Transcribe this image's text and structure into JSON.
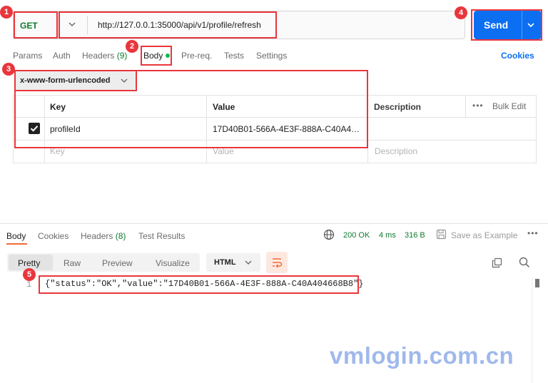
{
  "request": {
    "method": "GET",
    "url": "http://127.0.0.1:35000/api/v1/profile/refresh",
    "send_label": "Send"
  },
  "request_tabs": [
    {
      "label": "Params"
    },
    {
      "label": "Auth"
    },
    {
      "label": "Headers",
      "count": "(9)"
    },
    {
      "label": "Body",
      "active": true
    },
    {
      "label": "Pre-req."
    },
    {
      "label": "Tests"
    },
    {
      "label": "Settings"
    }
  ],
  "cookies_label": "Cookies",
  "body_type": "x-www-form-urlencoded",
  "params_table": {
    "headers": {
      "key": "Key",
      "value": "Value",
      "description": "Description"
    },
    "more_icon": "more-dots",
    "bulk_edit_label": "Bulk Edit",
    "rows": [
      {
        "checked": true,
        "key": "profileId",
        "value": "17D40B01-566A-4E3F-888A-C40A4…",
        "description": ""
      }
    ],
    "placeholder": {
      "key": "Key",
      "value": "Value",
      "description": "Description"
    }
  },
  "response": {
    "tabs": [
      {
        "label": "Body",
        "active": true
      },
      {
        "label": "Cookies"
      },
      {
        "label": "Headers",
        "count": "(8)"
      },
      {
        "label": "Test Results"
      }
    ],
    "status": "200 OK",
    "time": "4 ms",
    "size": "316 B",
    "save_label": "Save as Example",
    "formats": [
      "Pretty",
      "Raw",
      "Preview",
      "Visualize"
    ],
    "active_format": "Pretty",
    "language": "HTML",
    "line_number": "1",
    "code": "{\"status\":\"OK\",\"value\":\"17D40B01-566A-4E3F-888A-C40A404668B8\"}"
  },
  "annotations": [
    "1",
    "2",
    "3",
    "4",
    "5"
  ],
  "watermark": "vmlogin.com.cn",
  "colors": {
    "accent": "#0c6ff2",
    "method_get": "#0f7a2e",
    "annotation_red": "#e9363c",
    "active_tab_underline": "#f26b3a"
  }
}
